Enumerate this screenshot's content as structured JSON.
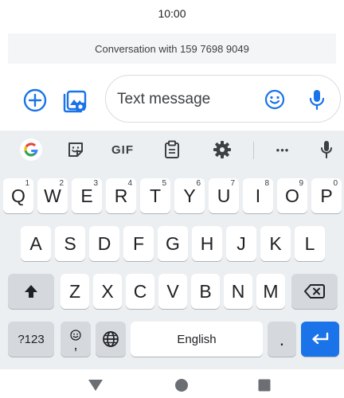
{
  "status_bar": {
    "time": "10:00"
  },
  "conversation": {
    "banner": "Conversation with 159 7698 9049"
  },
  "compose": {
    "placeholder": "Text message",
    "add_icon": "plus-circle-icon",
    "gallery_icon": "gallery-icon",
    "emoji_icon": "emoji-icon",
    "mic_icon": "microphone-icon"
  },
  "keyboard_toolbar": {
    "gif_label": "GIF",
    "more_label": "•••"
  },
  "keyboard": {
    "row1": [
      {
        "label": "Q",
        "hint": "1"
      },
      {
        "label": "W",
        "hint": "2"
      },
      {
        "label": "E",
        "hint": "3"
      },
      {
        "label": "R",
        "hint": "4"
      },
      {
        "label": "T",
        "hint": "5"
      },
      {
        "label": "Y",
        "hint": "6"
      },
      {
        "label": "U",
        "hint": "7"
      },
      {
        "label": "I",
        "hint": "8"
      },
      {
        "label": "O",
        "hint": "9"
      },
      {
        "label": "P",
        "hint": "0"
      }
    ],
    "row2": [
      "A",
      "S",
      "D",
      "F",
      "G",
      "H",
      "J",
      "K",
      "L"
    ],
    "row3": [
      "Z",
      "X",
      "C",
      "V",
      "B",
      "N",
      "M"
    ],
    "symbols_label": "?123",
    "comma_label": ",",
    "space_label": "English",
    "period_label": "."
  },
  "colors": {
    "accent": "#1a73e8",
    "keyboard_bg": "#eceff1",
    "function_key": "#d5d9de"
  }
}
